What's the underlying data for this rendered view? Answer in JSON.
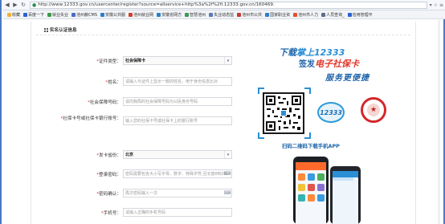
{
  "browser": {
    "url": "http://www.12333.gov.cn/usercenter/register?source=allservice+http%3a%2f%2fi.12333.gov.cn/160469.",
    "back_icon": "back-arrow-icon",
    "forward_icon": "forward-arrow-icon",
    "bookmarks": [
      {
        "label": "收藏",
        "color": "#f2b233"
      },
      {
        "label": "百度一下",
        "color": "#2a62d6"
      },
      {
        "label": "就业失业",
        "color": "#3c9a4a"
      },
      {
        "label": "池州献CMS",
        "color": "#4a6ac6"
      },
      {
        "label": "安徽公共服",
        "color": "#2b7fd0"
      },
      {
        "label": "池州就业网",
        "color": "#d3402a"
      },
      {
        "label": "安徽省网方",
        "color": "#2a80c8"
      },
      {
        "label": "智慧池州",
        "color": "#3b9a59"
      },
      {
        "label": "失业动态监",
        "color": "#5a78bd"
      },
      {
        "label": "池州市公共",
        "color": "#c33a34"
      },
      {
        "label": "国家职业资",
        "color": "#2e7fd1"
      },
      {
        "label": "池州市人力",
        "color": "#e0522e"
      },
      {
        "label": "人员查询_",
        "color": "#5f6e8a"
      },
      {
        "label": "信用管理平",
        "color": "#2a62d6"
      }
    ]
  },
  "section": {
    "title": "实名认证信息"
  },
  "form": {
    "rows": [
      {
        "label": "证件类型：",
        "required": true,
        "value": "社会保障卡",
        "kind": "select"
      },
      {
        "label": "姓名：",
        "required": true,
        "placeholder": "请输入与证件上显示一致的姓名，用于身份信息比对",
        "kind": "input"
      },
      {
        "label": "社会保障号码：",
        "required": true,
        "placeholder": "请向我局的社会保障号码为公民身份号码",
        "kind": "input"
      },
      {
        "label": "社保卡号或社保卡银行账号：",
        "required": true,
        "placeholder": "输入您的社保卡号或社保卡上的银行账号",
        "kind": "input",
        "two_line": true
      },
      {
        "label": "发卡省份：",
        "required": true,
        "value": "北京",
        "kind": "select"
      },
      {
        "label": "登录密码：",
        "required": true,
        "placeholder": "密码需要包含大小写字母、数字、特殊字符,且长度8到20",
        "kind": "input",
        "icon": "keyboard-icon"
      },
      {
        "label": "密码确认：",
        "required": true,
        "placeholder": "再次密码输入一次",
        "kind": "input",
        "icon": "keyboard-icon"
      },
      {
        "label": "手机号：",
        "required": true,
        "placeholder": "请输入正确的手机号码",
        "kind": "input"
      }
    ]
  },
  "promo": {
    "line1_prefix": "下载",
    "line1_highlight": "掌上12333",
    "line2_prefix": "签发",
    "line2_highlight": "电子社保卡",
    "line3": "服务更便捷",
    "scan_text": "扫码二维码下载手机APP",
    "logo_text": "12333",
    "seal_icon": "national-emblem-icon"
  }
}
